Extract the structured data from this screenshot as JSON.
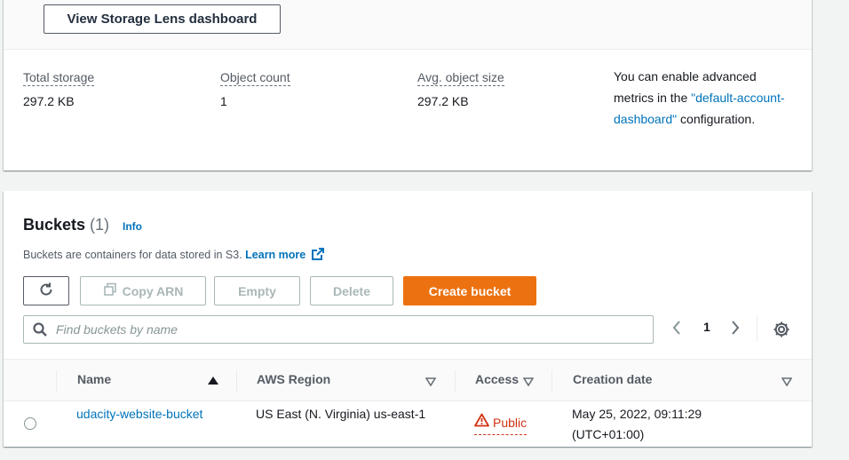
{
  "top_panel": {
    "lens_button": "View Storage Lens dashboard",
    "metrics": [
      {
        "label": "Total storage",
        "value": "297.2 KB"
      },
      {
        "label": "Object count",
        "value": "1"
      },
      {
        "label": "Avg. object size",
        "value": "297.2 KB"
      }
    ],
    "advanced": {
      "prefix": "You can enable advanced metrics in the ",
      "link": "\"default-account-dashboard\"",
      "suffix": " configuration."
    }
  },
  "buckets": {
    "title": "Buckets",
    "count": "(1)",
    "info": "Info",
    "description": "Buckets are containers for data stored in S3.",
    "learn_more": "Learn more",
    "actions": {
      "copy_arn": "Copy ARN",
      "empty": "Empty",
      "delete": "Delete",
      "create": "Create bucket"
    },
    "search_placeholder": "Find buckets by name",
    "pagination": {
      "current_page": "1"
    },
    "columns": [
      "Name",
      "AWS Region",
      "Access",
      "Creation date"
    ],
    "rows": [
      {
        "name": "udacity-website-bucket",
        "region": "US East (N. Virginia) us-east-1",
        "access": "Public",
        "created": "May 25, 2022, 09:11:29 (UTC+01:00)"
      }
    ]
  },
  "colors": {
    "accent_orange": "#ec7211",
    "link_blue": "#0073bb",
    "public_red": "#d13212"
  },
  "icons": [
    "refresh-icon",
    "copy-icon",
    "external-link-icon",
    "search-icon",
    "chevron-left-icon",
    "chevron-right-icon",
    "gear-icon",
    "sort-ascending-icon",
    "sort-descending-icon",
    "warning-icon"
  ]
}
